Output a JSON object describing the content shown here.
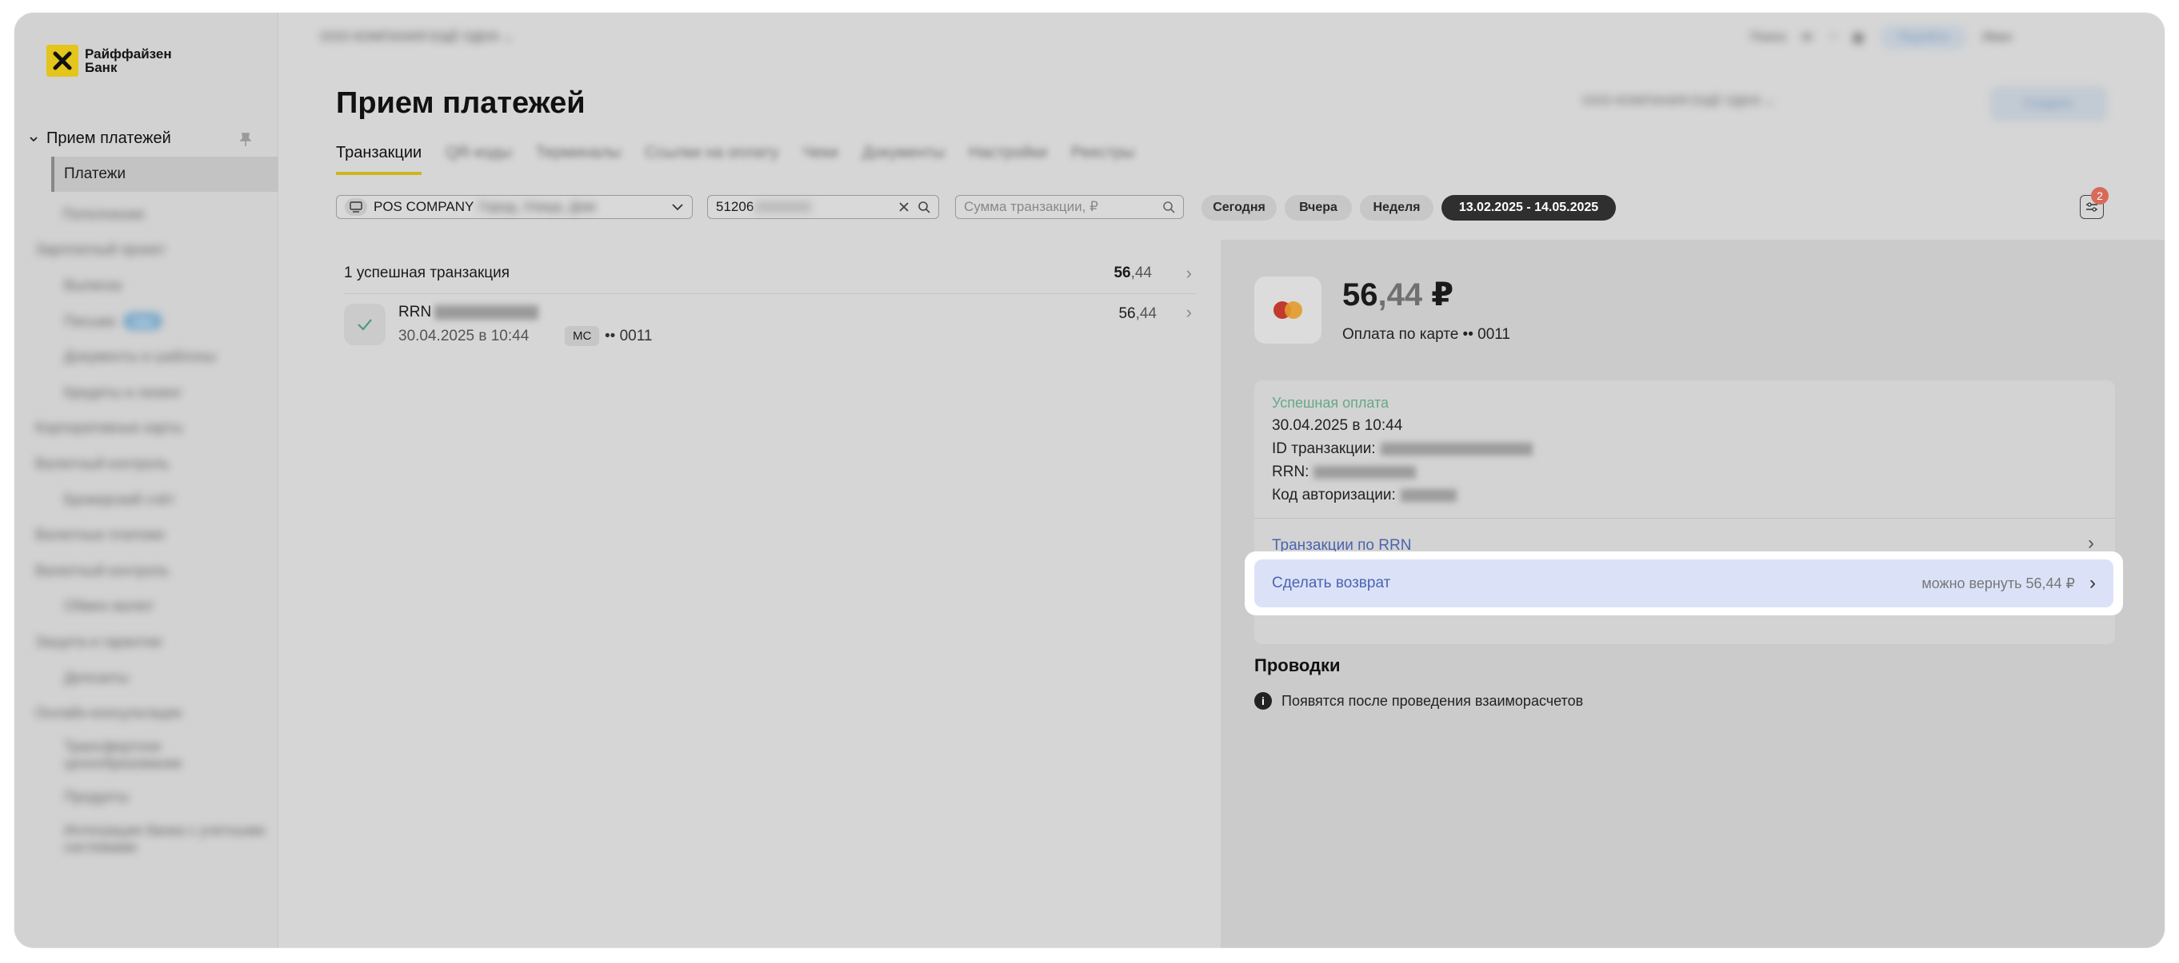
{
  "brand": {
    "name": "Райффайзен Банк",
    "accent": "#e3c51b"
  },
  "sidebar": {
    "section": "Прием платежей",
    "active_item": "Платежи",
    "items": [
      "Пополнение",
      "Зарплатный проект",
      "Выписка",
      "Письма",
      "Документы и шаблоны",
      "Кредиты и лизинг",
      "Корпоративные карты",
      "Валютный контроль",
      "Брокерский счёт",
      "Валютные платежи",
      "Валютный контроль",
      "Обмен валют",
      "Защита и гарантии",
      "Депозиты",
      "Онлайн-консультации",
      "Трансфертное ценообразование",
      "Продукты",
      "Интеграция банка с учетными системами"
    ],
    "new_badge": "new"
  },
  "topbar": {
    "company": "ООО КОМПАНИЯ ЕЩЁ ОДНА",
    "search": "Поиск",
    "cta": "Перейти",
    "user": "Иван"
  },
  "page": {
    "title": "Прием платежей",
    "account_selector": "ООО КОМПАНИЯ ЕЩЁ ОДНА",
    "header_button": "Создать"
  },
  "tabs": [
    "Транзакции",
    "QR-коды",
    "Терминалы",
    "Ссылки на оплату",
    "Чеки",
    "Документы",
    "Настройки",
    "Реестры"
  ],
  "filters": {
    "pos_label": "POS COMPANY",
    "pos_hidden": "Город, Улица, Дом",
    "search_value": "51206",
    "sum_placeholder": "Сумма транзакции, ₽",
    "period_buttons": [
      "Сегодня",
      "Вчера",
      "Неделя"
    ],
    "date_range": "13.02.2025 - 14.05.2025",
    "filter_count": "2"
  },
  "list": {
    "summary": "1 успешная транзакция",
    "summary_amount_int": "56",
    "summary_amount_cents": ",44",
    "rows": [
      {
        "rrn_label": "RRN",
        "date": "30.04.2025 в 10:44",
        "card_brand": "MC",
        "card_last": "•• 0011",
        "amount_int": "56",
        "amount_cents": ",44"
      }
    ]
  },
  "detail": {
    "amount_int": "56",
    "amount_cents": ",44",
    "currency": "₽",
    "subtitle": "Оплата по карте •• 0011",
    "status": "Успешная оплата",
    "datetime": "30.04.2025 в 10:44",
    "transaction_id_label": "ID транзакции:",
    "rrn_label": "RRN:",
    "auth_code_label": "Код авторизации:",
    "rrn_link": "Транзакции по RRN",
    "refund_label": "Сделать возврат",
    "refund_available": "можно вернуть 56,44 ₽",
    "postings_title": "Проводки",
    "postings_info": "Появятся после проведения взаиморасчетов"
  }
}
